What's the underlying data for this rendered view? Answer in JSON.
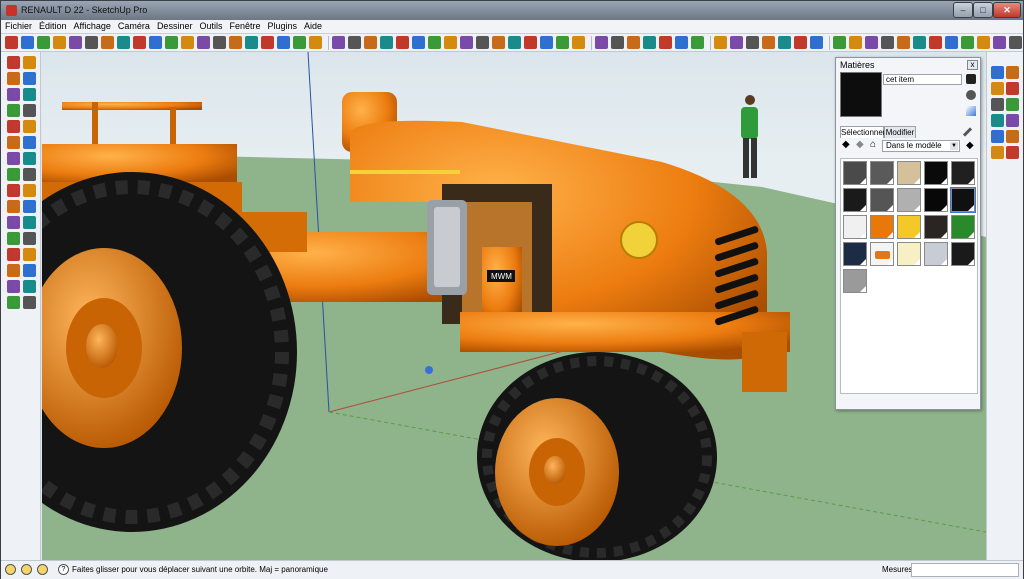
{
  "window": {
    "title": "RENAULT D 22 - SketchUp Pro",
    "min_glyph": "–",
    "max_glyph": "□",
    "close_glyph": "✕"
  },
  "menu": [
    "Fichier",
    "Édition",
    "Affichage",
    "Caméra",
    "Dessiner",
    "Outils",
    "Fenêtre",
    "Plugins",
    "Aide"
  ],
  "toolbar_icons": [
    "arrow",
    "pencil",
    "rect",
    "circle",
    "arc",
    "shape",
    "eraser",
    "tape",
    "paint",
    "push",
    "move",
    "rotate",
    "follow",
    "scale",
    "offset",
    "tape2",
    "dim",
    "protract",
    "text",
    "axes",
    "3dtext",
    "orbit",
    "pan",
    "zoom",
    "zoomwin",
    "zoomext",
    "prev",
    "next",
    "camera",
    "walk",
    "look",
    "section",
    "sandbox",
    "warehouse",
    "component",
    "extension",
    "layers",
    "iso",
    "top",
    "front",
    "right",
    "back",
    "left",
    "bottom",
    "xray",
    "wire",
    "hidden",
    "shaded",
    "textured",
    "mono",
    "plugin1",
    "plugin2",
    "plugin3",
    "plugin4",
    "plugin5",
    "plugin6",
    "plugin7",
    "plugin8",
    "plugin9",
    "plugin10",
    "plugin11",
    "plugin12"
  ],
  "viewport": {
    "engine_label": "MWM"
  },
  "materials_panel": {
    "title": "Matières",
    "close_glyph": "x",
    "material_name": "cet item",
    "tabs": [
      "Sélectionner",
      "Modifier"
    ],
    "collection": "Dans le modèle",
    "swatches": [
      {
        "color": "#4a4a4a"
      },
      {
        "color": "#5a5a5a"
      },
      {
        "color": "#d4c09a"
      },
      {
        "color": "#0a0a0a"
      },
      {
        "color": "#202020"
      },
      {
        "color": "#1a1a1a"
      },
      {
        "color": "#555555"
      },
      {
        "color": "#b0b0b0"
      },
      {
        "color": "#080808"
      },
      {
        "color": "#101010",
        "selected": true
      },
      {
        "color": "#f0f0f0"
      },
      {
        "color": "#e8780a"
      },
      {
        "color": "#f5c82a"
      },
      {
        "color": "#2a2422"
      },
      {
        "color": "#2a8a2a"
      },
      {
        "color": "#1c2c44"
      },
      {
        "color": "#e07818",
        "tractor": true
      },
      {
        "color": "#f7f0c4"
      },
      {
        "color": "#c8ccd4"
      },
      {
        "color": "#1a1a1a"
      },
      {
        "color": "#9a9a9a"
      }
    ]
  },
  "status": {
    "text": "Faites glisser pour vous déplacer suivant une orbite.  Maj = panoramique",
    "mesures": "Mesures",
    "help_glyph": "?"
  },
  "colors": {
    "orange": "#e8790a",
    "ground": "#8fb38a",
    "sky": "#e3ecf0",
    "tire": "#141414"
  }
}
